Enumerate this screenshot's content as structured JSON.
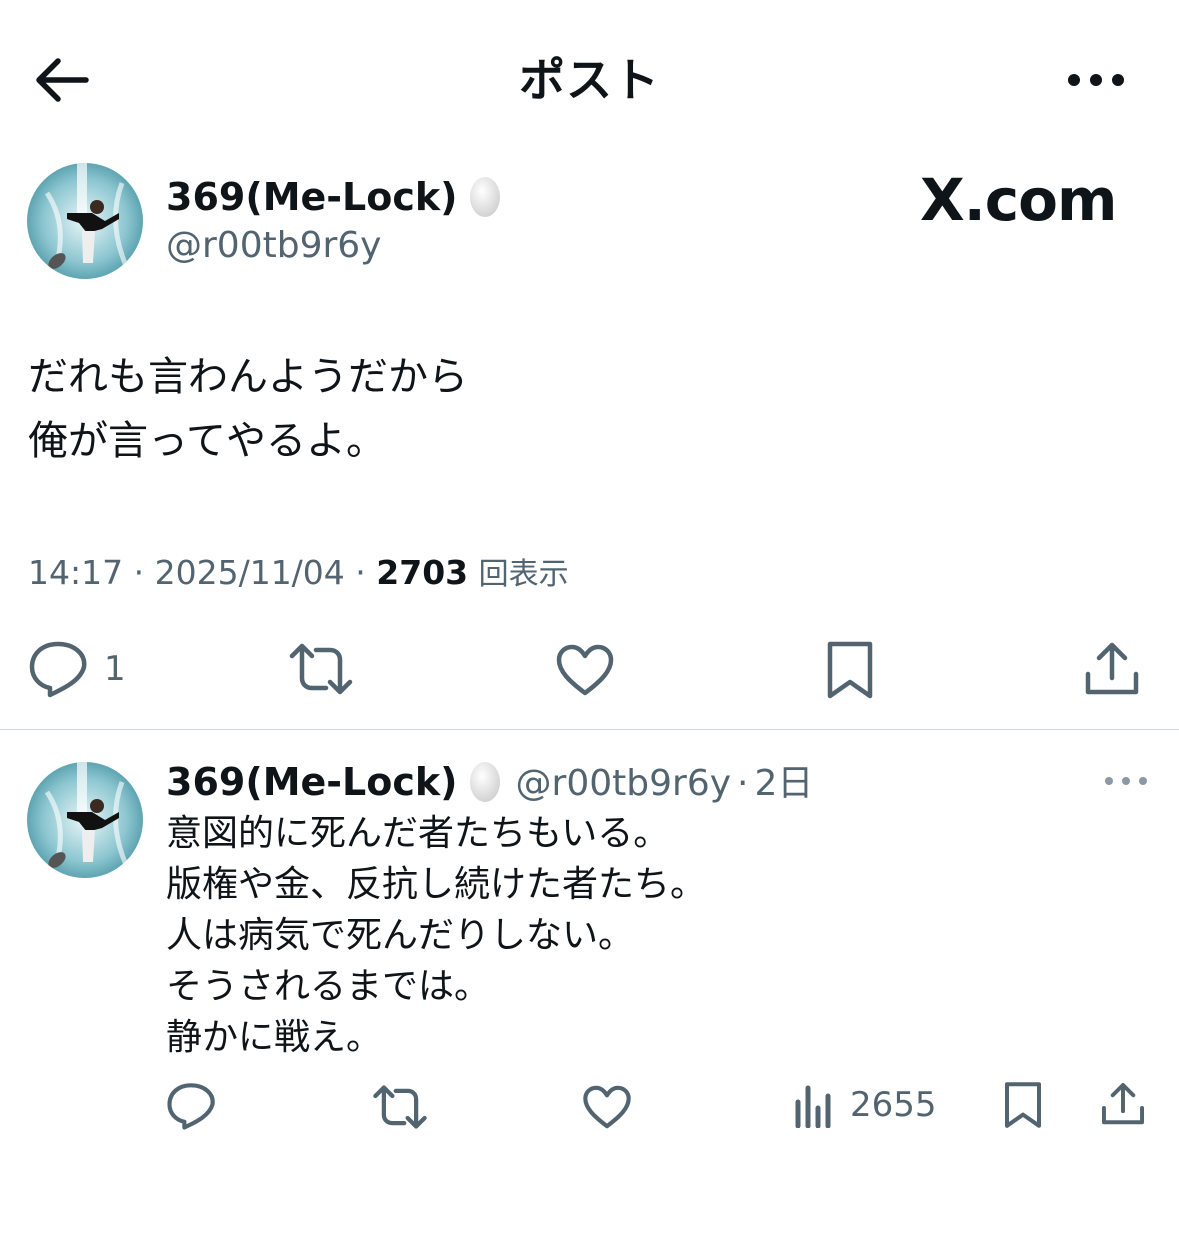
{
  "header": {
    "title": "ポスト"
  },
  "post": {
    "author": {
      "display_name": "369(Me-Lock)",
      "handle": "@r00tb9r6y",
      "badge_icon": "egg-icon"
    },
    "brand_watermark": "X.com",
    "text_lines": [
      "だれも言わんようだから",
      "俺が言ってやるよ。"
    ],
    "time": "14:17",
    "date": "2025/11/04",
    "views_count": "2703",
    "views_label": "回表示",
    "actions": {
      "reply_count": "1",
      "icons": [
        "reply-icon",
        "repost-icon",
        "like-icon",
        "bookmark-icon",
        "share-icon"
      ]
    }
  },
  "reply": {
    "author": {
      "display_name": "369(Me-Lock)",
      "handle": "@r00tb9r6y",
      "age": "2日"
    },
    "text_lines": [
      "意図的に死んだ者たちもいる。",
      "版権や金、反抗し続けた者たち。",
      "人は病気で死んだりしない。",
      "そうされるまでは。",
      "静かに戦え。"
    ],
    "actions": {
      "views_count": "2655",
      "icons": [
        "reply-icon",
        "repost-icon",
        "like-icon",
        "analytics-icon",
        "bookmark-icon",
        "share-icon"
      ]
    }
  },
  "colors": {
    "text_primary": "#0f1419",
    "text_secondary": "#536471",
    "divider": "#cfd9de",
    "background": "#ffffff"
  }
}
